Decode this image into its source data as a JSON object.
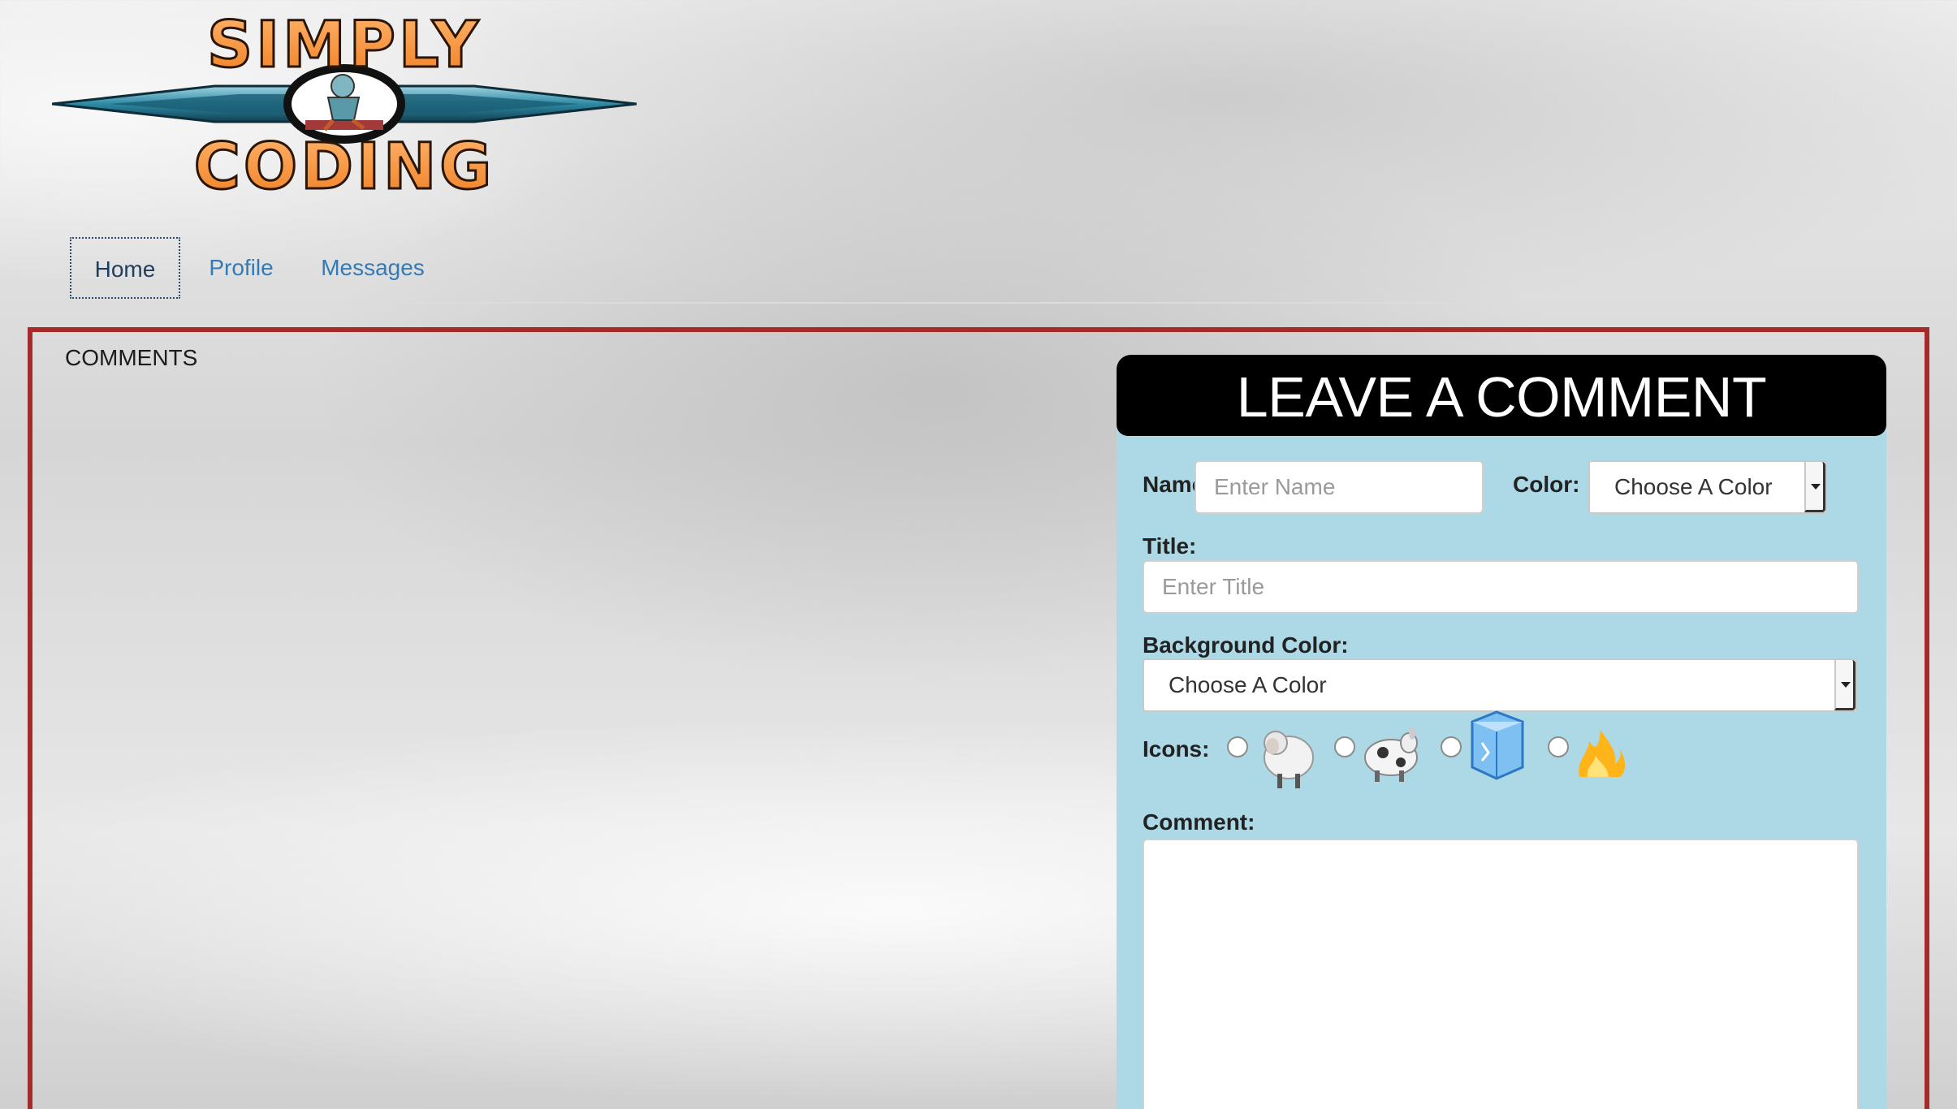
{
  "logo": {
    "top_word": "SIMPLY",
    "bottom_word": "CODING",
    "brand_orange": "#f7923a",
    "brand_teal": "#2d8aa3"
  },
  "nav": {
    "tabs": [
      {
        "label": "Home",
        "active": true
      },
      {
        "label": "Profile",
        "active": false
      },
      {
        "label": "Messages",
        "active": false
      }
    ]
  },
  "comments": {
    "heading": "COMMENTS"
  },
  "form": {
    "header": "LEAVE A COMMENT",
    "name_label": "Name:",
    "name_placeholder": "Enter Name",
    "color_label": "Color:",
    "color_selected": "Choose A Color",
    "title_label": "Title:",
    "title_placeholder": "Enter Title",
    "bg_color_label": "Background Color:",
    "bg_color_selected": "Choose A Color",
    "icons_label": "Icons:",
    "icon_options": [
      "sheep-icon",
      "cow-icon",
      "ice-cube-icon",
      "fire-icon"
    ],
    "comment_label": "Comment:",
    "comment_value": ""
  },
  "colors": {
    "panel_border": "#a52a2a",
    "form_background": "#add8e6",
    "header_background": "#000000",
    "link": "#337ab7"
  }
}
